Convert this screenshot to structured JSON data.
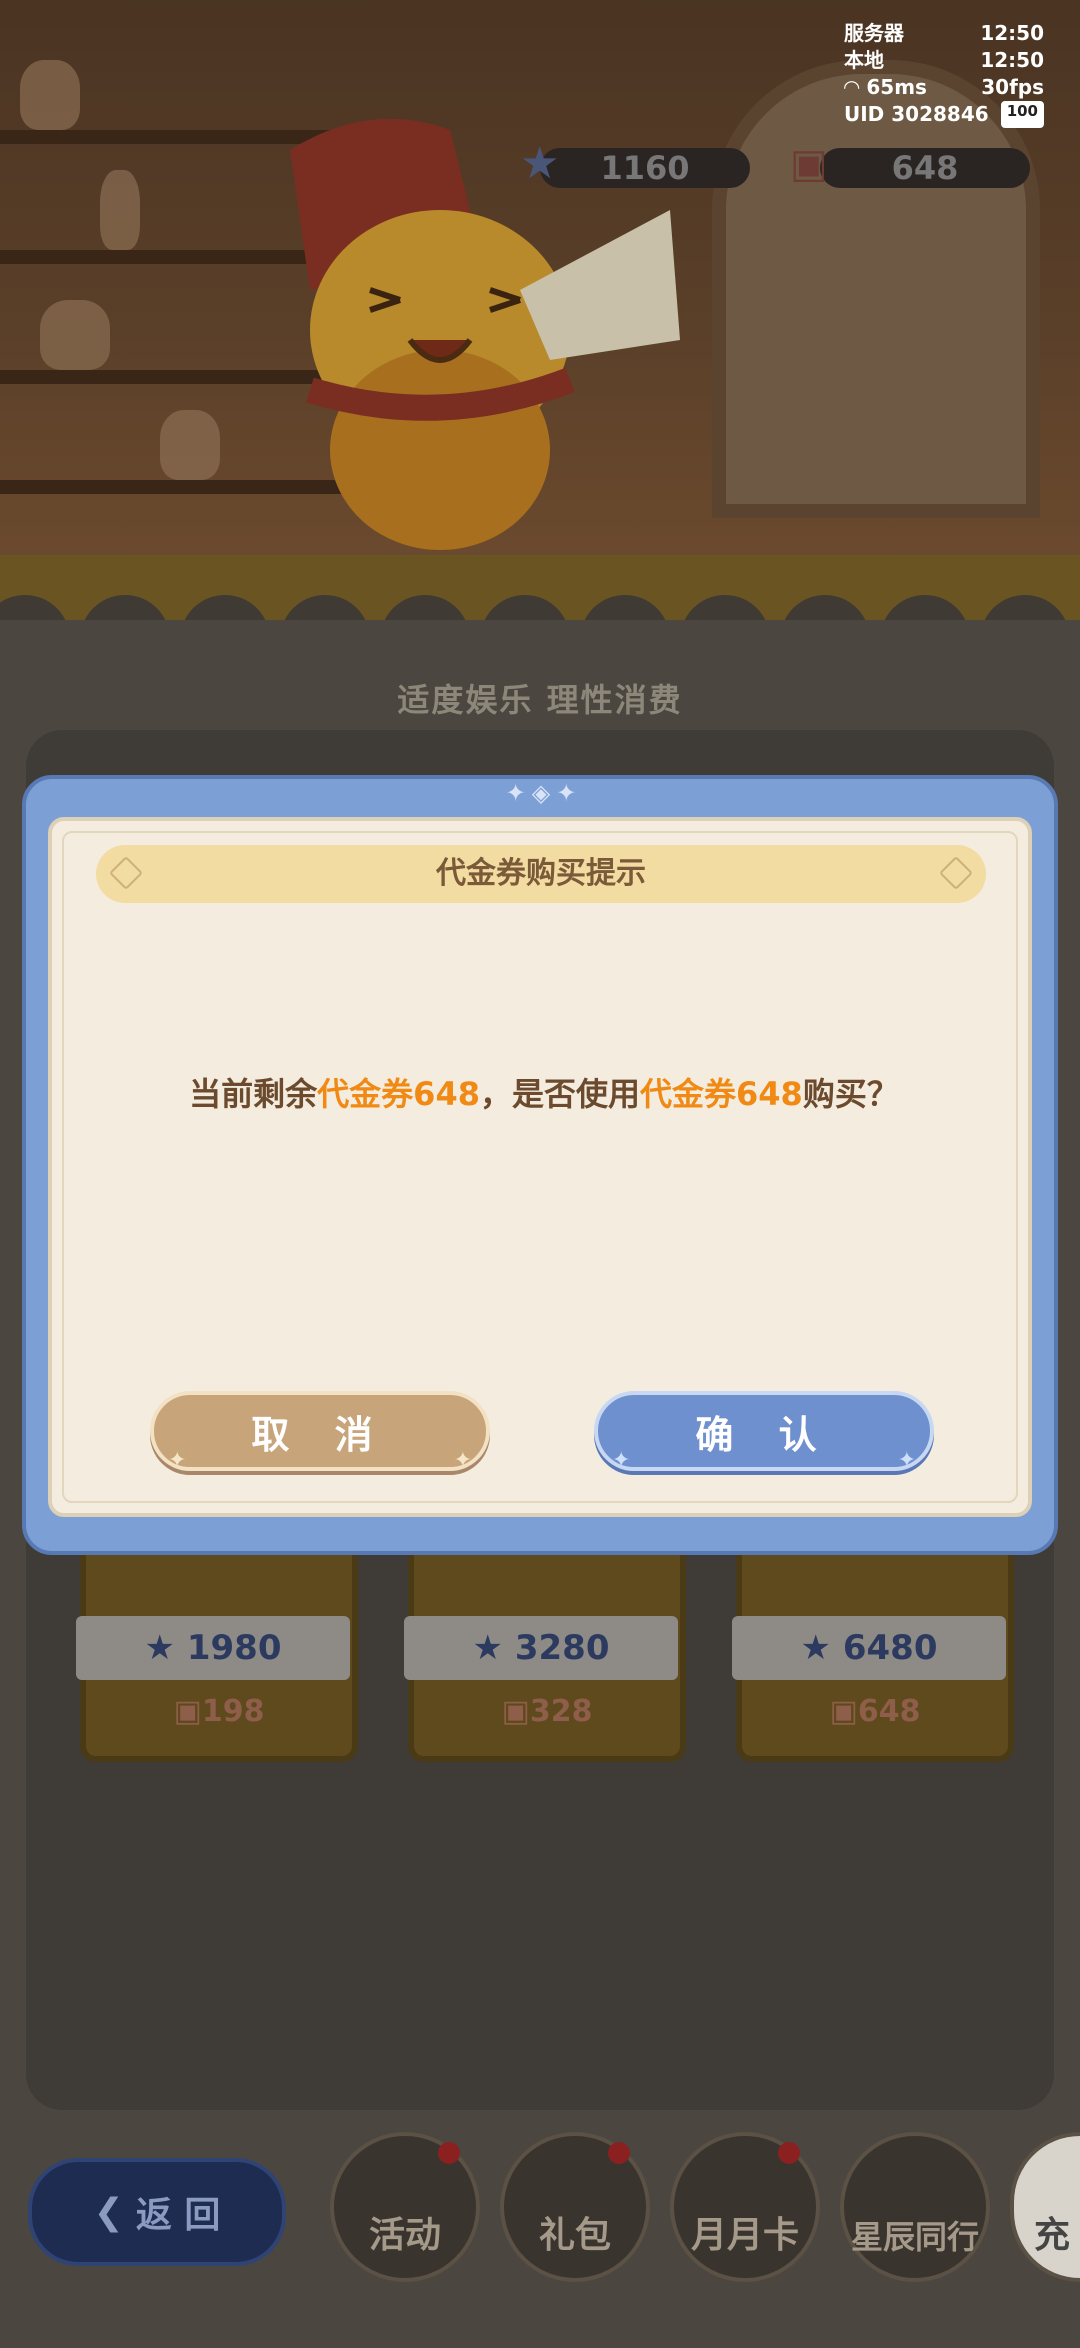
{
  "status": {
    "server_label": "服务器",
    "server_time": "12:50",
    "local_label": "本地",
    "local_time": "12:50",
    "ping": "65ms",
    "fps": "30fps",
    "uid": "UID 3028846",
    "battery": "100"
  },
  "currency": {
    "stars": "1160",
    "vouchers": "648"
  },
  "slogan": "适度娱乐  理性消费",
  "products": [
    {
      "price": "1980",
      "voucher_price": "198"
    },
    {
      "price": "3280",
      "voucher_price": "328"
    },
    {
      "price": "6480",
      "voucher_price": "648"
    }
  ],
  "dialog": {
    "title": "代金券购买提示",
    "message_part1": "当前剩余",
    "message_hl1": "代金券648",
    "message_part2": "，是否使用",
    "message_hl2": "代金券648",
    "message_part3": "购买？",
    "cancel_label": "取 消",
    "confirm_label": "确 认"
  },
  "bottom_nav": {
    "back_label": "返 回",
    "tabs": [
      {
        "label": "活动"
      },
      {
        "label": "礼包"
      },
      {
        "label": "月月卡"
      },
      {
        "label": "星辰同行"
      },
      {
        "label": "充"
      }
    ]
  },
  "colors": {
    "dialog_frame": "#7ca0d6",
    "dialog_bg": "#f4eddf",
    "highlight_orange": "#f08a14",
    "cancel_button": "#c8a47a",
    "confirm_button": "#6f90cf"
  }
}
